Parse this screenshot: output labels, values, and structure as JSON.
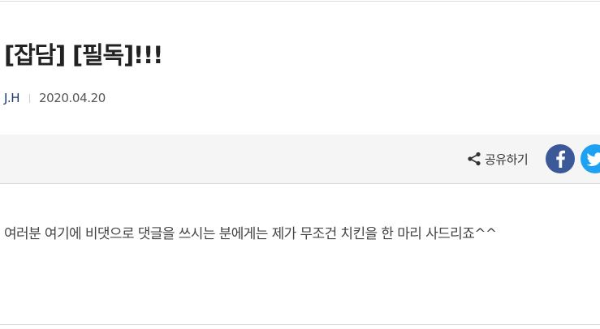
{
  "post": {
    "title": "[잡담] [필독]!!!",
    "author": "J.H",
    "date": "2020.04.20",
    "body": "여러분 여기에 비댓으로 댓글을 쓰시는 분에게는 제가 무조건 치킨을 한 마리 사드리죠^^"
  },
  "share": {
    "label": "공유하기",
    "icons": {
      "share": "share-icon",
      "facebook": "facebook-icon",
      "twitter": "twitter-icon"
    }
  },
  "colors": {
    "facebook": "#3b5998",
    "twitter": "#1da1f2",
    "author": "#1a3a6b",
    "share_bar_bg": "#f5f5f5"
  }
}
